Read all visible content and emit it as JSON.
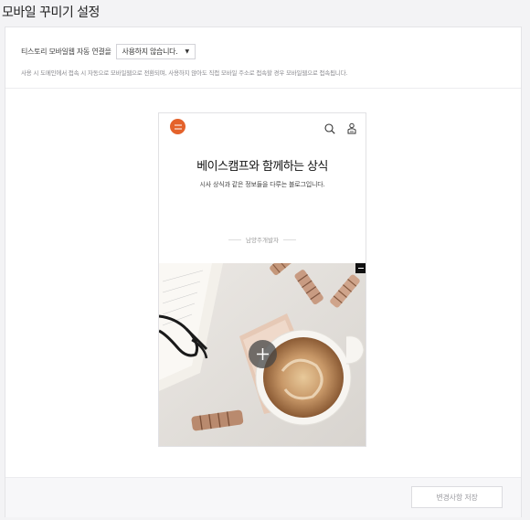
{
  "page": {
    "title": "모바일 꾸미기 설정"
  },
  "settings": {
    "auto_connect_label": "티스토리 모바일웹 자동 연결을",
    "auto_connect_value": "사용하지 않습니다.",
    "help_text": "사용 시 도메인에서 접속 시 자동으로 모바일웹으로 전환되며, 사용하지 않아도 직접 모바일 주소로 접속할 경우 모바일웹으로 접속됩니다."
  },
  "preview": {
    "blog_title": "베이스캠프와 함께하는 상식",
    "blog_description": "시사 상식과 같은 정보들을 다루는 블로그입니다.",
    "blog_owner": "남양주개발자",
    "accent_color": "#e4622b"
  },
  "footer": {
    "save_label": "변경사항 저장"
  },
  "icons": [
    "menu-icon",
    "search-icon",
    "profile-icon",
    "remove-icon",
    "add-icon",
    "chevron-down-icon"
  ]
}
